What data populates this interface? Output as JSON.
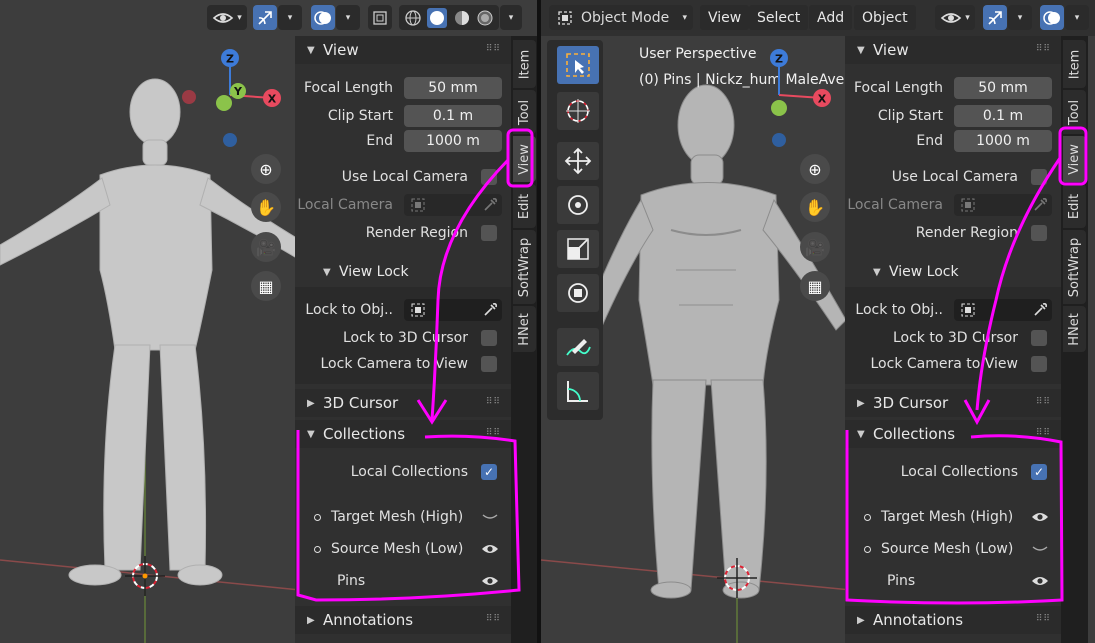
{
  "left": {
    "header": {
      "view_options_icon": "eye-dropdown-icon",
      "gizmo_icon": "gizmo-icon",
      "overlay_icon": "overlay-icon",
      "xray_icon": "xray-icon"
    },
    "tabs": [
      "Item",
      "Tool",
      "View",
      "Edit",
      "SoftWrap",
      "HNet"
    ],
    "active_tab": "View",
    "panel": {
      "view_section": "View",
      "focal_length_label": "Focal Length",
      "focal_length_value": "50 mm",
      "clip_start_label": "Clip Start",
      "clip_start_value": "0.1 m",
      "end_label": "End",
      "end_value": "1000 m",
      "use_local_camera_label": "Use Local Camera",
      "local_camera_label": "Local Camera",
      "render_region_label": "Render Region",
      "view_lock_section": "View Lock",
      "lock_to_obj_label": "Lock to Obj..",
      "lock_to_3d_cursor_label": "Lock to 3D Cursor",
      "lock_camera_label": "Lock Camera to View",
      "cursor_section": "3D Cursor",
      "collections_section": "Collections",
      "local_collections_label": "Local Collections",
      "collections": [
        {
          "name": "Target Mesh (High)",
          "visible": false
        },
        {
          "name": "Source Mesh (Low)",
          "visible": true
        },
        {
          "name": "Pins",
          "visible": true
        }
      ],
      "annotations_section": "Annotations"
    },
    "gizmo": {
      "z": "Z",
      "y": "Y",
      "x": "X"
    }
  },
  "right": {
    "header": {
      "mode": "Object Mode",
      "menus": [
        "View",
        "Select",
        "Add",
        "Object"
      ]
    },
    "overlay_text": {
      "perspective": "User Perspective",
      "object": "(0) Pins | Nickz_hum   MaleAve"
    },
    "tabs": [
      "Item",
      "Tool",
      "View",
      "Edit",
      "SoftWrap",
      "HNet"
    ],
    "active_tab": "View",
    "panel": {
      "view_section": "View",
      "focal_length_label": "Focal Length",
      "focal_length_value": "50 mm",
      "clip_start_label": "Clip Start",
      "clip_start_value": "0.1 m",
      "end_label": "End",
      "end_value": "1000 m",
      "use_local_camera_label": "Use Local Camera",
      "local_camera_label": "Local Camera",
      "render_region_label": "Render Region",
      "view_lock_section": "View Lock",
      "lock_to_obj_label": "Lock to Obj..",
      "lock_to_3d_cursor_label": "Lock to 3D Cursor",
      "lock_camera_label": "Lock Camera to View",
      "cursor_section": "3D Cursor",
      "collections_section": "Collections",
      "local_collections_label": "Local Collections",
      "collections": [
        {
          "name": "Target Mesh (High)",
          "visible": true
        },
        {
          "name": "Source Mesh (Low)",
          "visible": false
        },
        {
          "name": "Pins",
          "visible": true
        }
      ],
      "annotations_section": "Annotations"
    },
    "gizmo": {
      "z": "Z",
      "x": "X"
    }
  },
  "colors": {
    "accent": "#4772b3",
    "annotation": "#ff00ff",
    "x_axis": "#e84a5f",
    "y_axis": "#8bc34a",
    "z_axis": "#3d7bd9"
  }
}
